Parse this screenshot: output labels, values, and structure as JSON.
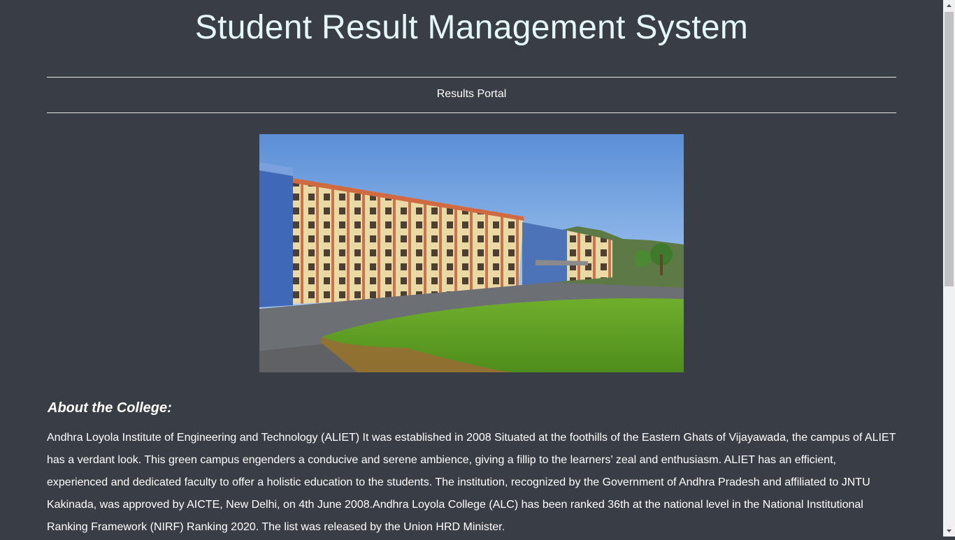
{
  "header": {
    "title": "Student Result Management System"
  },
  "nav": {
    "results_portal": "Results Portal"
  },
  "about": {
    "heading": "About the College:",
    "paragraph": "Andhra Loyola Institute of Engineering and Technology (ALIET) It was established in 2008 Situated at the foothills of the Eastern Ghats of Vijayawada, the campus of ALIET has a verdant look. This green campus engenders a conducive and serene ambience, giving a fillip to the learners’ zeal and enthusiasm. ALIET has an efficient, experienced and dedicated faculty to offer a holistic education to the students. The institution, recognized by the Government of Andhra Pradesh and affiliated to JNTU Kakinada, was approved by AICTE, New Delhi, on 4th June 2008.Andhra Loyola College (ALC) has been ranked 36th at the national level in the National Institutional Ranking Framework (NIRF) Ranking 2020. The list was released by the Union HRD Minister."
  },
  "colors": {
    "background": "#393d45",
    "title": "#e4f7fb",
    "text": "#ffffff",
    "rule": "#e8e8e8"
  },
  "scrollbar": {
    "position_fraction": 0.0
  }
}
